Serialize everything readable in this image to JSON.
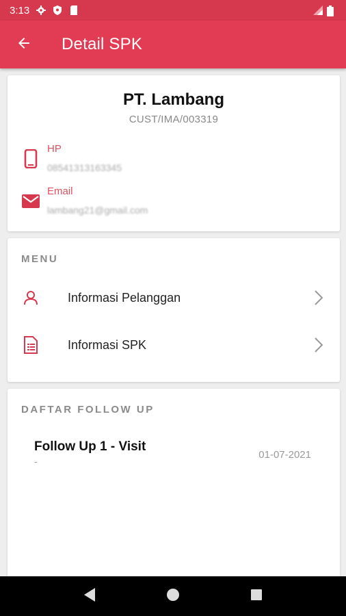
{
  "status_bar": {
    "time": "3:13",
    "left_icons": [
      "gear-icon",
      "shield-icon",
      "sd-card-icon"
    ],
    "right_icons": [
      "signal-icon",
      "battery-icon"
    ]
  },
  "app_bar": {
    "title": "Detail SPK",
    "back_icon": "arrow-left-icon",
    "color": "#e23c54"
  },
  "profile": {
    "company_name": "PT. Lambang",
    "customer_code": "CUST/IMA/003319",
    "hp_label": "HP",
    "hp_value": "08541313163345",
    "email_label": "Email",
    "email_value": "lambang21@gmail.com"
  },
  "menu": {
    "title": "MENU",
    "items": [
      {
        "label": "Informasi Pelanggan",
        "icon": "user-icon"
      },
      {
        "label": "Informasi SPK",
        "icon": "document-icon"
      }
    ]
  },
  "follow_up": {
    "title": "DAFTAR FOLLOW UP",
    "items": [
      {
        "title": "Follow Up 1 - Visit",
        "subtitle": "-",
        "date": "01-07-2021"
      }
    ]
  },
  "nav_bar": {
    "buttons": [
      "back-triangle-icon",
      "home-circle-icon",
      "recents-square-icon"
    ]
  },
  "colors": {
    "accent": "#e23c54",
    "status_bar": "#d6384e",
    "label_red": "#e0515f"
  }
}
